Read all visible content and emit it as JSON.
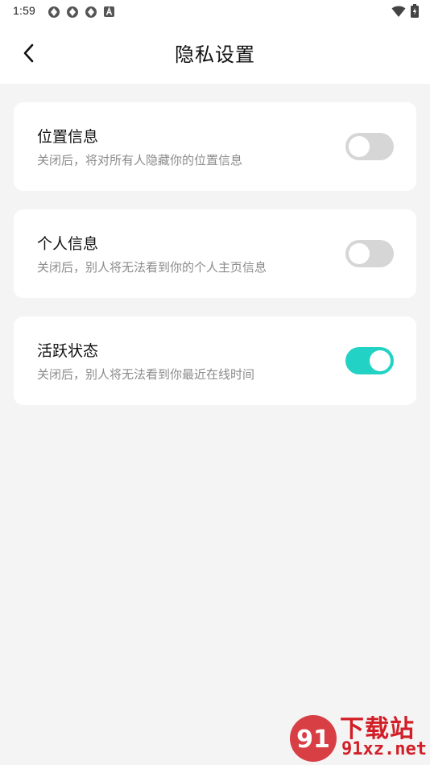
{
  "status_bar": {
    "time": "1:59",
    "left_icons": [
      "app-notification-icon",
      "app-notification-icon",
      "app-notification-icon",
      "a-notification-icon"
    ],
    "right_icons": [
      "wifi-icon",
      "battery-charging-icon"
    ]
  },
  "header": {
    "back_icon": "chevron-left-icon",
    "title": "隐私设置"
  },
  "settings": [
    {
      "title": "位置信息",
      "description": "关闭后，将对所有人隐藏你的位置信息",
      "enabled": false
    },
    {
      "title": "个人信息",
      "description": "关闭后，别人将无法看到你的个人主页信息",
      "enabled": false
    },
    {
      "title": "活跃状态",
      "description": "关闭后，别人将无法看到你最近在线时间",
      "enabled": true
    }
  ],
  "colors": {
    "accent": "#22d3c5",
    "toggle_off": "#d6d6d6",
    "background": "#f4f4f4",
    "watermark": "#d21e26"
  },
  "watermark": {
    "text": "下载站",
    "site": "91xz.net"
  }
}
